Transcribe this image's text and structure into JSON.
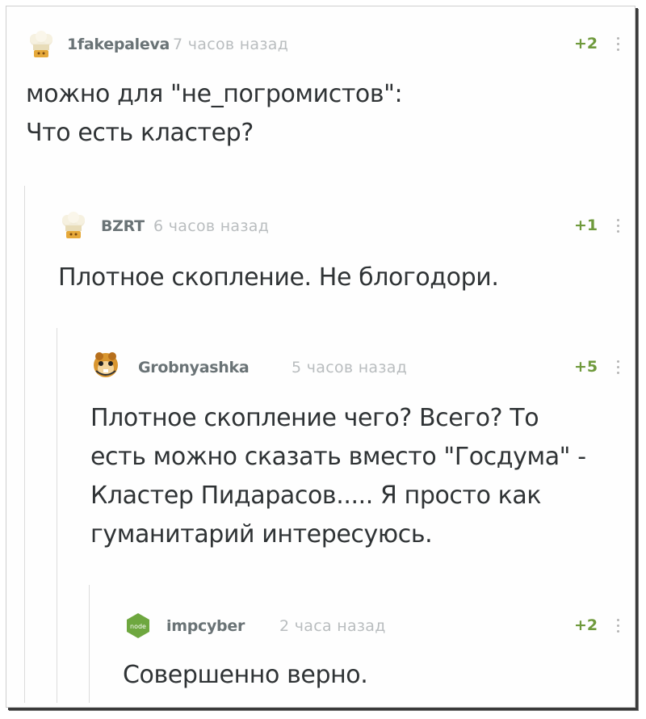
{
  "comments": [
    {
      "author": "1fakepaleva",
      "time": "7 часов назад",
      "rating": "+2",
      "avatar": "chef-hat-avatar",
      "lines": [
        "можно для \"не_погромистов\":",
        "Что есть кластер?"
      ]
    },
    {
      "author": "BZRT",
      "time": "6 часов назад",
      "rating": "+1",
      "avatar": "chef-hat-avatar",
      "lines": [
        "Плотное скопление. Не блогодори."
      ]
    },
    {
      "author": "Grobnyashka",
      "time": "5 часов назад",
      "rating": "+5",
      "avatar": "hamster-avatar",
      "lines": [
        "Плотное скопление чего? Всего? То",
        "есть можно сказать вместо \"Госдума\" -",
        "Кластер Пидарасов..... Я просто как",
        "гуманитарий интересуюсь."
      ]
    },
    {
      "author": "impcyber",
      "time": "2 часа назад",
      "rating": "+2",
      "avatar": "nodejs-hexagon-avatar",
      "avatar_text": "node",
      "lines": [
        "Совершенно верно."
      ]
    }
  ],
  "colors": {
    "author": "#6a7376",
    "time": "#b9bdbf",
    "rating": "#6f9a3c",
    "text": "#2f3335",
    "thread_line": "#dcdcdc"
  }
}
